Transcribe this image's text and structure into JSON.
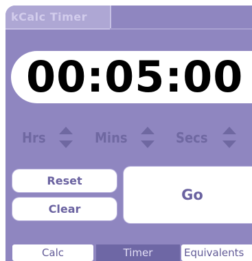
{
  "window": {
    "title": "kCalc Timer"
  },
  "display": {
    "time": "00:05:00"
  },
  "spinners": [
    {
      "label": "Hrs"
    },
    {
      "label": "Mins"
    },
    {
      "label": "Secs"
    }
  ],
  "buttons": {
    "reset": "Reset",
    "clear": "Clear",
    "go": "Go"
  },
  "tabs": [
    {
      "label": "Calc",
      "active": false
    },
    {
      "label": "Timer",
      "active": true
    },
    {
      "label": "Equivalents",
      "active": false
    }
  ],
  "colors": {
    "background": "#8f86c0",
    "accent": "#6e67a5",
    "button_face": "#ffffff",
    "label_text": "#6f68a1"
  },
  "icons": [
    "up-arrow-icon",
    "down-arrow-icon"
  ]
}
